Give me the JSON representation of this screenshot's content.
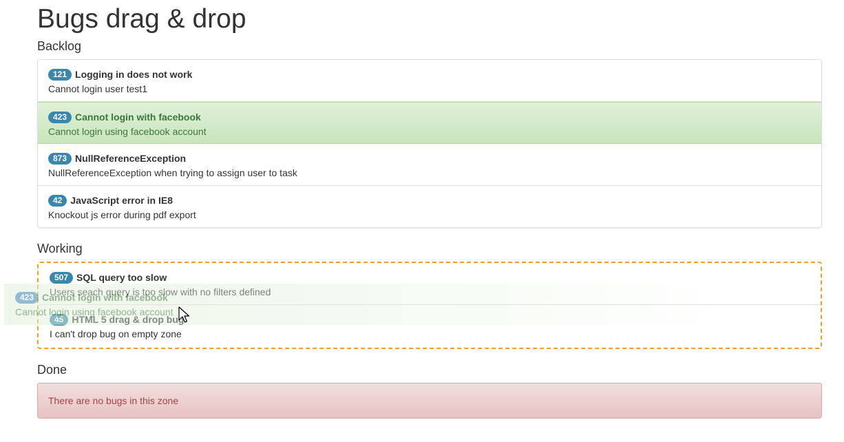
{
  "title": "Bugs drag & drop",
  "zones": {
    "backlog": {
      "label": "Backlog",
      "bugs": [
        {
          "id": "121",
          "title": "Logging in does not work",
          "desc": "Cannot login user test1"
        },
        {
          "id": "423",
          "title": "Cannot login with facebook",
          "desc": "Cannot login using facebook account"
        },
        {
          "id": "873",
          "title": "NullReferenceException",
          "desc": "NullReferenceException when trying to assign user to task"
        },
        {
          "id": "42",
          "title": "JavaScript error in IE8",
          "desc": "Knockout js error during pdf export"
        }
      ]
    },
    "working": {
      "label": "Working",
      "bugs": [
        {
          "id": "507",
          "title": "SQL query too slow",
          "desc": "Users seach query is too slow with no filters defined"
        },
        {
          "id": "45",
          "title": "HTML 5 drag & drop bug",
          "desc": "I can't drop bug on empty zone"
        }
      ]
    },
    "done": {
      "label": "Done",
      "empty_message": "There are no bugs in this zone"
    }
  },
  "drag_ghost": {
    "id": "423",
    "title": "Cannot login with facebook",
    "desc": "Cannot login using facebook account"
  },
  "colors": {
    "badge": "#3a87ad",
    "active_bg": "#dff0d8",
    "drop_target_border": "#f0a020",
    "empty_bg": "#f2dede",
    "empty_text": "#a94442"
  },
  "icons": {
    "cursor": "arrow-cursor-icon"
  }
}
